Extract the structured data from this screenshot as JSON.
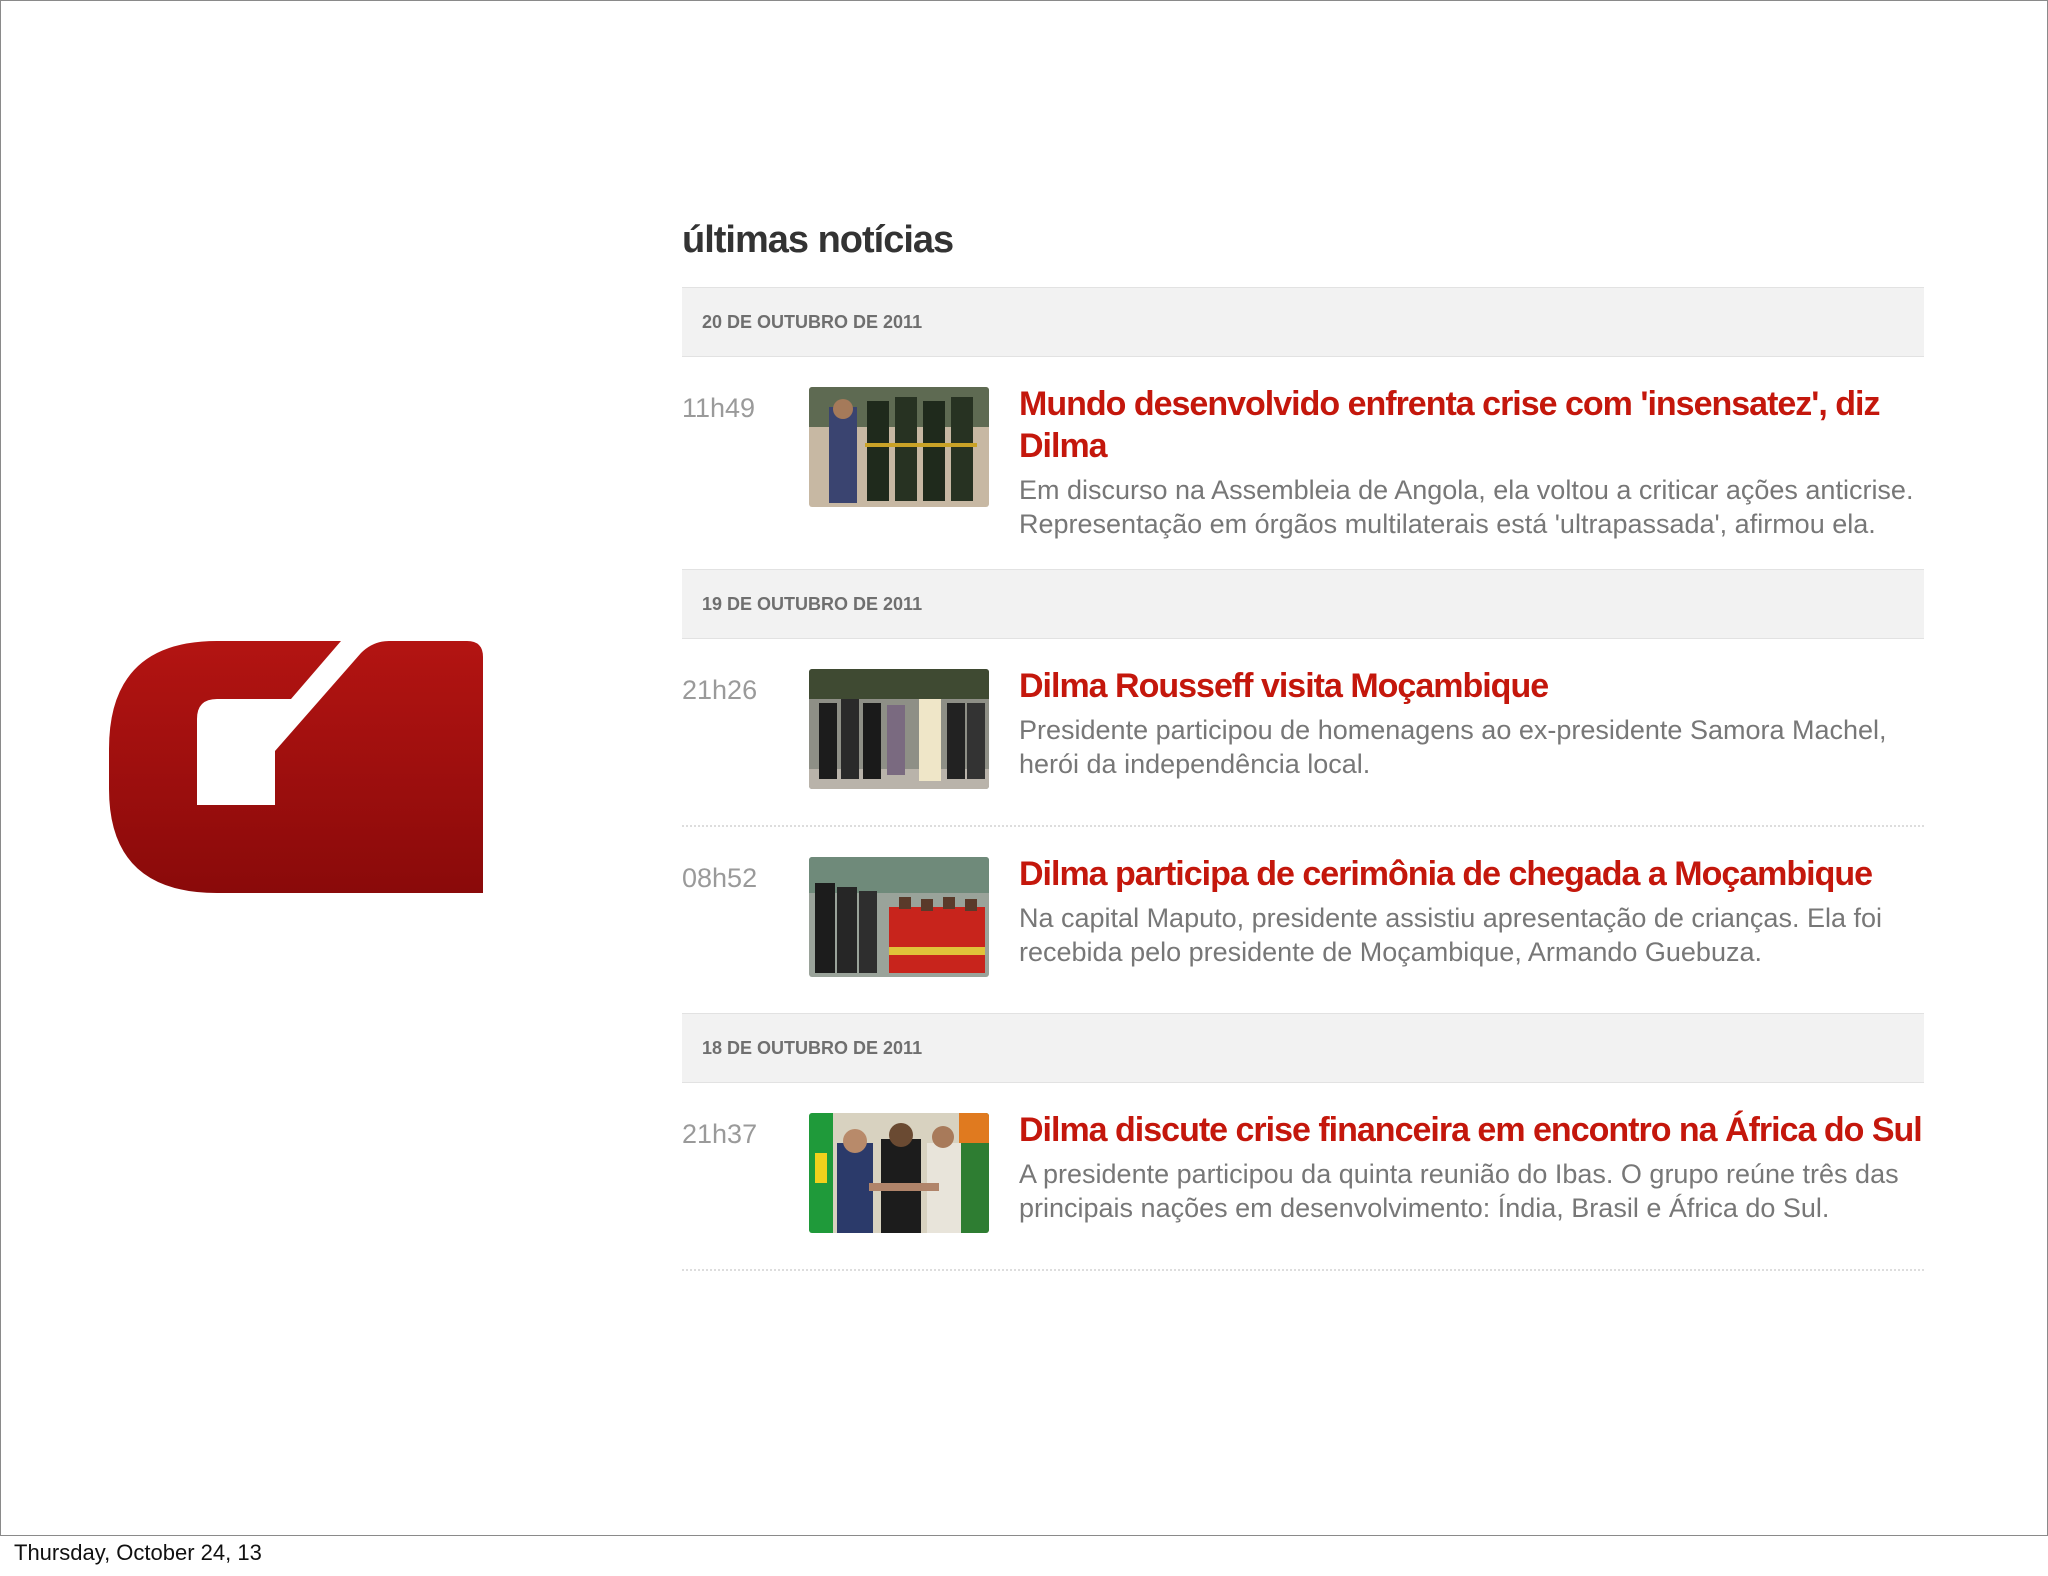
{
  "logo": {
    "name": "g1-logo",
    "color_top": "#b31412",
    "color_bottom": "#8a0a0a"
  },
  "feed": {
    "heading": "últimas notícias",
    "groups": [
      {
        "date": "20 DE OUTUBRO DE 2011",
        "items": [
          {
            "time": "11h49",
            "title": "Mundo desenvolvido enfrenta crise com 'insensatez', diz Dilma",
            "summary": "Em discurso na Assembleia de Angola, ela voltou a criticar ações anticrise. Representação em órgãos multilaterais está 'ultrapassada', afirmou ela."
          }
        ]
      },
      {
        "date": "19 DE OUTUBRO DE 2011",
        "items": [
          {
            "time": "21h26",
            "title": "Dilma Rousseff visita Moçambique",
            "summary": "Presidente participou de homenagens ao ex-presidente Samora Machel, herói da independência local."
          },
          {
            "time": "08h52",
            "title": "Dilma participa de cerimônia de chegada a Moçambique",
            "summary": "Na capital Maputo, presidente assistiu apresentação de crianças. Ela foi recebida pelo presidente de Moçambique, Armando Guebuza."
          }
        ]
      },
      {
        "date": "18 DE OUTUBRO DE 2011",
        "items": [
          {
            "time": "21h37",
            "title": "Dilma discute crise financeira em encontro na África do Sul",
            "summary": "A presidente participou da quinta reunião do Ibas. O grupo reúne três das principais nações em desenvolvimento: Índia, Brasil e África do Sul."
          }
        ]
      }
    ]
  },
  "footer": {
    "date": "Thursday, October 24, 13"
  },
  "colors": {
    "headline_red": "#c4170c",
    "date_bar_bg": "#f2f2f2",
    "summary_gray": "#777777",
    "time_gray": "#9a9a9a"
  }
}
